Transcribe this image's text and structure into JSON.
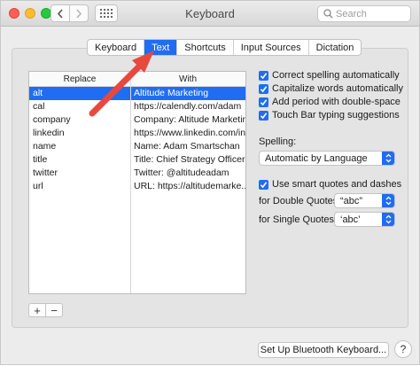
{
  "window": {
    "title": "Keyboard"
  },
  "search": {
    "placeholder": "Search"
  },
  "tabs": [
    {
      "label": "Keyboard",
      "active": false
    },
    {
      "label": "Text",
      "active": true
    },
    {
      "label": "Shortcuts",
      "active": false
    },
    {
      "label": "Input Sources",
      "active": false
    },
    {
      "label": "Dictation",
      "active": false
    }
  ],
  "table": {
    "headers": {
      "replace": "Replace",
      "with": "With"
    },
    "rows": [
      {
        "replace": "alt",
        "with": "Altitude Marketing",
        "selected": true
      },
      {
        "replace": "cal",
        "with": "https://calendly.com/adam",
        "selected": false
      },
      {
        "replace": "company",
        "with": "Company: Altitude Marketing",
        "selected": false
      },
      {
        "replace": "linkedin",
        "with": "https://www.linkedin.com/in",
        "selected": false
      },
      {
        "replace": "name",
        "with": "Name: Adam Smartschan",
        "selected": false
      },
      {
        "replace": "title",
        "with": "Title: Chief Strategy Officer",
        "selected": false
      },
      {
        "replace": "twitter",
        "with": "Twitter: @altitudeadam",
        "selected": false
      },
      {
        "replace": "url",
        "with": "URL: https://altitudemarke...",
        "selected": false
      }
    ]
  },
  "table_buttons": {
    "add": "+",
    "remove": "−"
  },
  "options": {
    "correct_spelling": {
      "label": "Correct spelling automatically",
      "checked": true
    },
    "capitalize": {
      "label": "Capitalize words automatically",
      "checked": true
    },
    "add_period": {
      "label": "Add period with double-space",
      "checked": true
    },
    "touch_bar": {
      "label": "Touch Bar typing suggestions",
      "checked": true
    },
    "smart_quotes": {
      "label": "Use smart quotes and dashes",
      "checked": true
    }
  },
  "spelling": {
    "label": "Spelling:",
    "value": "Automatic by Language"
  },
  "double_quotes": {
    "label": "for Double Quotes",
    "value": "“abc”"
  },
  "single_quotes": {
    "label": "for Single Quotes",
    "value": "‘abc’"
  },
  "bluetooth_button": {
    "label": "Set Up Bluetooth Keyboard..."
  },
  "help": {
    "label": "?"
  },
  "colors": {
    "accent": "#1f6df2",
    "annotation_arrow": "#e8493f"
  }
}
